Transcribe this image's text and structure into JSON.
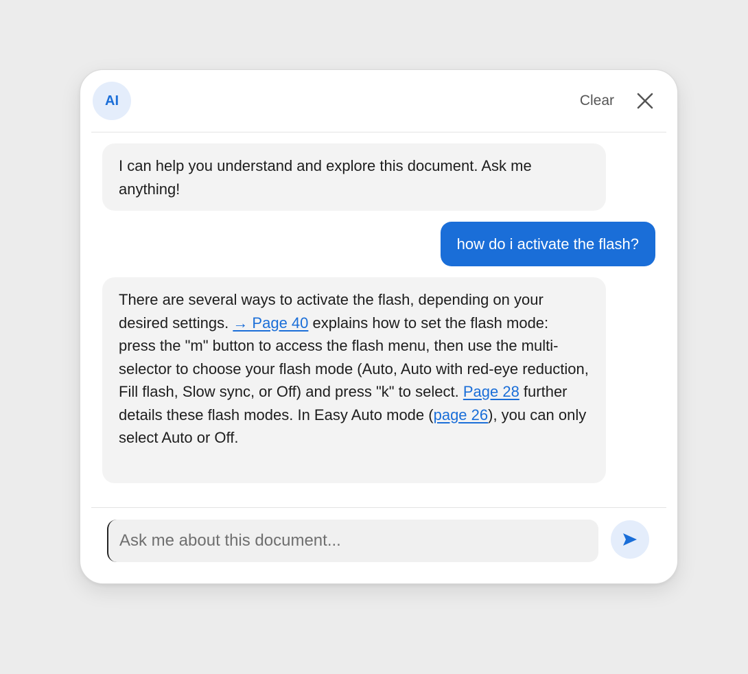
{
  "header": {
    "avatar_label": "AI",
    "clear_label": "Clear",
    "close_icon": "close-icon"
  },
  "messages": {
    "greeting": "I can help you understand and explore this document. Ask me anything!",
    "user_question": "how do i activate the flash?",
    "answer": {
      "part1": "There are several ways to activate the flash, depending on your desired settings. ",
      "link1": "→ Page 40",
      "part2": " explains how to set the flash mode: press the \"m\" button to access the flash menu, then use the multi-selector to choose your flash mode (Auto, Auto with red-eye reduction, Fill flash, Slow sync, or Off) and press \"k\" to select. ",
      "link2": "Page 28",
      "part3": " further details these flash modes. In Easy Auto mode (",
      "link3": "page 26",
      "part4": "), you can only select Auto or Off."
    }
  },
  "composer": {
    "placeholder": "Ask me about this document...",
    "value": "",
    "send_icon": "send-icon"
  },
  "colors": {
    "accent": "#1a6ed8",
    "ai_bubble": "#f3f3f3",
    "avatar_bg": "#e4edfb",
    "page_bg": "#ececec"
  }
}
